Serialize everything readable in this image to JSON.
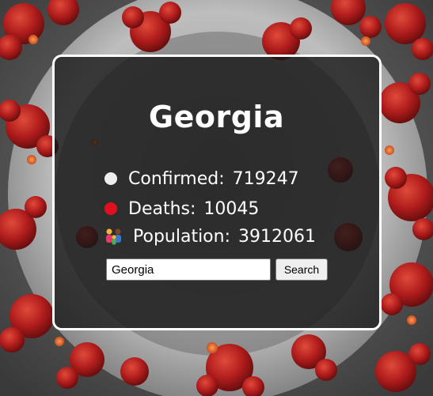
{
  "country": {
    "name": "Georgia"
  },
  "stats": {
    "confirmed_label": "Confirmed:",
    "confirmed_value": "719247",
    "deaths_label": "Deaths:",
    "deaths_value": "10045",
    "population_label": "Population:",
    "population_value": "3912061"
  },
  "icons": {
    "confirmed": "white-dot-icon",
    "deaths": "red-dot-icon",
    "population": "family-icon"
  },
  "search": {
    "value": "Georgia",
    "button_label": "Search"
  },
  "colors": {
    "confirmed_dot": "#eeeeee",
    "deaths_dot": "#e0111e",
    "card_border": "#ffffff",
    "background_virus_spikes": "#b01c1c"
  }
}
